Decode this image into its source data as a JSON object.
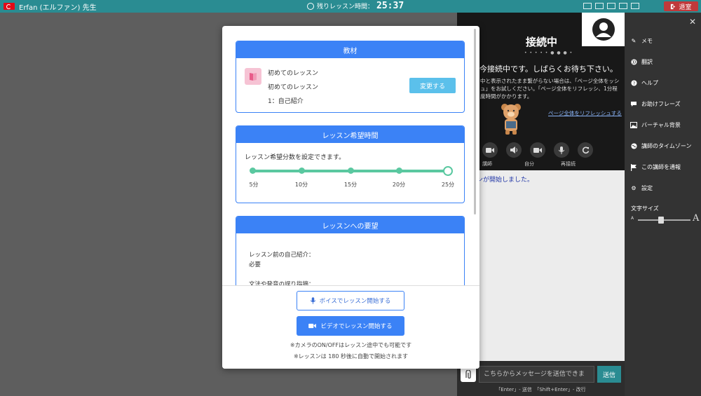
{
  "topbar": {
    "teacher_name": "Erfan (エルファン) 先生",
    "timer_label": "残りレッスン時間：",
    "timer_value": "25:37",
    "exit_label": "退室",
    "flag": "turkey-flag",
    "bar_color": "#2a8c92"
  },
  "video": {
    "status_title": "接続中",
    "status_message": "今接続中です。しばらくお待ち下さい。",
    "help_text": "中と表示されたまま繋がらない場合は、「ページ全体をッシュ」をお試しください。「ページ全体をリフレッシ、1分程度時間がかかります。",
    "refresh_link": "ページ全体をリフレッシュする",
    "labels": {
      "teacher": "講師",
      "self": "自分",
      "reconnect": "再接続"
    }
  },
  "chat": {
    "first_message": "ンが開始しました。",
    "input_placeholder": "こちらからメッセージを送信できま",
    "send_label": "送信",
    "hint": "「Enter」- 送信　「Shift+Enter」- 改行"
  },
  "sidebar": {
    "items": [
      {
        "label": "メモ",
        "icon": "edit-icon"
      },
      {
        "label": "翻訳",
        "icon": "globe-icon"
      },
      {
        "label": "ヘルプ",
        "icon": "help-icon"
      },
      {
        "label": "お助けフレーズ",
        "icon": "chat-bubble-icon"
      },
      {
        "label": "バーチャル背景",
        "icon": "image-icon"
      },
      {
        "label": "講師のタイムゾーン",
        "icon": "world-icon"
      },
      {
        "label": "この講師を通報",
        "icon": "flag-icon"
      },
      {
        "label": "設定",
        "icon": "gear-icon"
      }
    ],
    "font_size_label": "文字サイズ",
    "font_size_level": 0.45
  },
  "modal": {
    "material": {
      "header": "教材",
      "line1": "初めてのレッスン",
      "line2": "初めてのレッスン",
      "line3": "1：自己紹介",
      "change_button": "変更する"
    },
    "duration": {
      "header": "レッスン希望時間",
      "description": "レッスン希望分数を設定できます。",
      "options": [
        "5分",
        "10分",
        "15分",
        "20分",
        "25分"
      ],
      "selected": "25分"
    },
    "requests": {
      "header": "レッスンへの要望",
      "item1_label": "レッスン前の自己紹介：",
      "item1_value": "必要",
      "item2_label": "文法や発音の誤り指摘："
    },
    "voice_button": "ボイスでレッスン開始する",
    "video_button": "ビデオでレッスン開始する",
    "note1": "※カメラのON/OFFはレッスン途中でも可能です",
    "note2": "※レッスンは 180 秒後に自動で開始されます"
  }
}
